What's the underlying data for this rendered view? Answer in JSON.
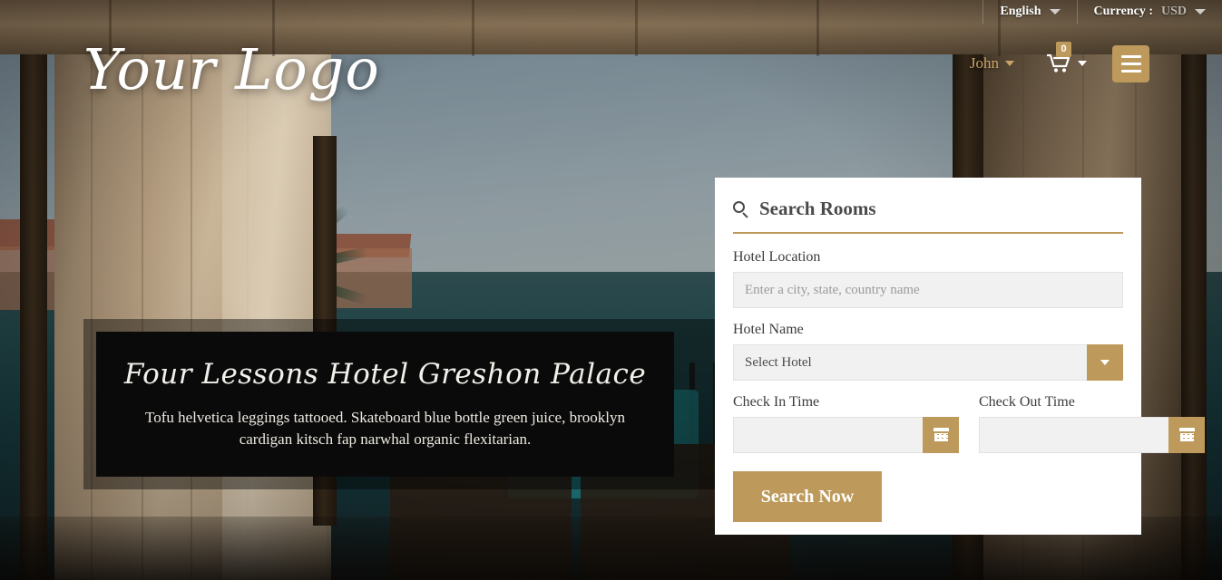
{
  "topbar": {
    "language": "English",
    "currency_label": "Currency :",
    "currency_value": "USD",
    "language_caret_icon": "chevron-down-icon",
    "currency_caret_icon": "chevron-down-icon"
  },
  "header": {
    "logo": "Your Logo",
    "user_name": "John",
    "user_caret_icon": "chevron-down-icon",
    "cart_icon": "shopping-cart-icon",
    "cart_count": "0",
    "cart_caret_icon": "chevron-down-icon",
    "menu_icon": "hamburger-menu-icon"
  },
  "hero": {
    "title": "Four Lessons Hotel Greshon Palace",
    "subtitle": "Tofu helvetica leggings tattooed. Skateboard blue bottle green juice, brooklyn cardigan kitsch fap narwhal organic flexitarian."
  },
  "search_panel": {
    "title": "Search Rooms",
    "search_icon": "search-icon",
    "location": {
      "label": "Hotel Location",
      "placeholder": "Enter a city, state, country name",
      "value": ""
    },
    "hotel_name": {
      "label": "Hotel Name",
      "selected": "Select Hotel",
      "arrow_icon": "chevron-down-icon"
    },
    "check_in": {
      "label": "Check In Time",
      "placeholder": "",
      "value": "",
      "calendar_icon": "calendar-icon"
    },
    "check_out": {
      "label": "Check Out Time",
      "placeholder": "",
      "value": "",
      "calendar_icon": "calendar-icon"
    },
    "submit_label": "Search Now"
  },
  "colors": {
    "gold": "#bd9a5b",
    "panel_bg": "#ffffff",
    "input_bg": "#f1f1f1",
    "user_gold": "#c9a468"
  }
}
